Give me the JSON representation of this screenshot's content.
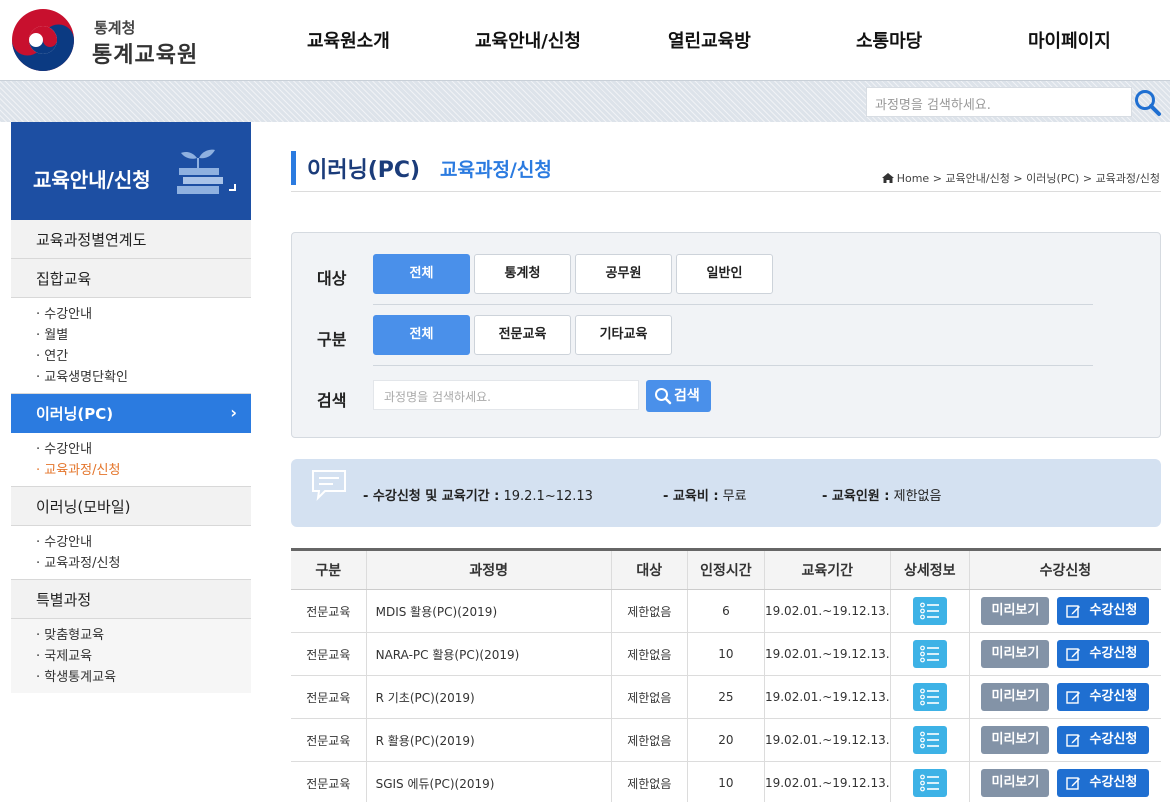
{
  "header": {
    "org_small": "통계청",
    "org_main": "통계교육원",
    "nav": [
      "교육원소개",
      "교육안내/신청",
      "열린교육방",
      "소통마당",
      "마이페이지"
    ]
  },
  "top_search": {
    "placeholder": "과정명을 검색하세요."
  },
  "sidebar": {
    "title": "교육안내/신청",
    "menu": {
      "m1": "교육과정별연계도",
      "m2": "집합교육",
      "m2_subs": [
        "수강안내",
        "월별",
        "연간",
        "교육생명단확인"
      ],
      "m3": "이러닝(PC)",
      "m3_chevron": "›",
      "m3_subs": [
        "수강안내",
        "교육과정/신청"
      ],
      "m4": "이러닝(모바일)",
      "m4_subs": [
        "수강안내",
        "교육과정/신청"
      ],
      "m5": "특별과정",
      "m5_subs": [
        "맞춤형교육",
        "국제교육",
        "학생통계교육"
      ]
    }
  },
  "page": {
    "title": "이러닝(PC)",
    "subtitle": "교육과정/신청",
    "breadcrumb": [
      "Home",
      "교육안내/신청",
      "이러닝(PC)",
      "교육과정/신청"
    ],
    "breadcrumb_sep": ">"
  },
  "filter": {
    "target_label": "대상",
    "target_options": [
      "전체",
      "통계청",
      "공무원",
      "일반인"
    ],
    "target_selected": "전체",
    "type_label": "구분",
    "type_options": [
      "전체",
      "전문교육",
      "기타교육"
    ],
    "type_selected": "전체",
    "search_label": "검색",
    "search_placeholder": "과정명을 검색하세요.",
    "search_button": "검색"
  },
  "info": {
    "period_label": "- 수강신청 및 교육기간 :",
    "period_value": "19.2.1~12.13",
    "fee_label": "- 교육비 :",
    "fee_value": "무료",
    "capacity_label": "- 교육인원 :",
    "capacity_value": "제한없음"
  },
  "table": {
    "headers": [
      "구분",
      "과정명",
      "대상",
      "인정시간",
      "교육기간",
      "상세정보",
      "수강신청"
    ],
    "preview_label": "미리보기",
    "apply_label": "수강신청",
    "rows": [
      {
        "category": "전문교육",
        "name": "MDIS 활용(PC)(2019)",
        "target": "제한없음",
        "hours": "6",
        "period": "19.02.01.~19.12.13."
      },
      {
        "category": "전문교육",
        "name": "NARA-PC 활용(PC)(2019)",
        "target": "제한없음",
        "hours": "10",
        "period": "19.02.01.~19.12.13."
      },
      {
        "category": "전문교육",
        "name": "R 기초(PC)(2019)",
        "target": "제한없음",
        "hours": "25",
        "period": "19.02.01.~19.12.13."
      },
      {
        "category": "전문교육",
        "name": "R 활용(PC)(2019)",
        "target": "제한없음",
        "hours": "20",
        "period": "19.02.01.~19.12.13."
      },
      {
        "category": "전문교육",
        "name": "SGIS 에듀(PC)(2019)",
        "target": "제한없음",
        "hours": "10",
        "period": "19.02.01.~19.12.13."
      }
    ]
  },
  "colors": {
    "primary": "#2b7be0",
    "sidebar_head": "#1d4fa3",
    "apply_button": "#1f6fd1",
    "preview_button": "#8393a7",
    "detail_button": "#3db2e6",
    "current_submenu": "#e4752b"
  },
  "icons": {
    "logo": "taegeuk-emblem",
    "top_search": "search-icon",
    "sidebar_head": "books-plant-icon",
    "breadcrumb_home": "home-icon",
    "info": "speech-bubble-icon",
    "detail": "list-icon",
    "apply": "pencil-edit-icon"
  }
}
